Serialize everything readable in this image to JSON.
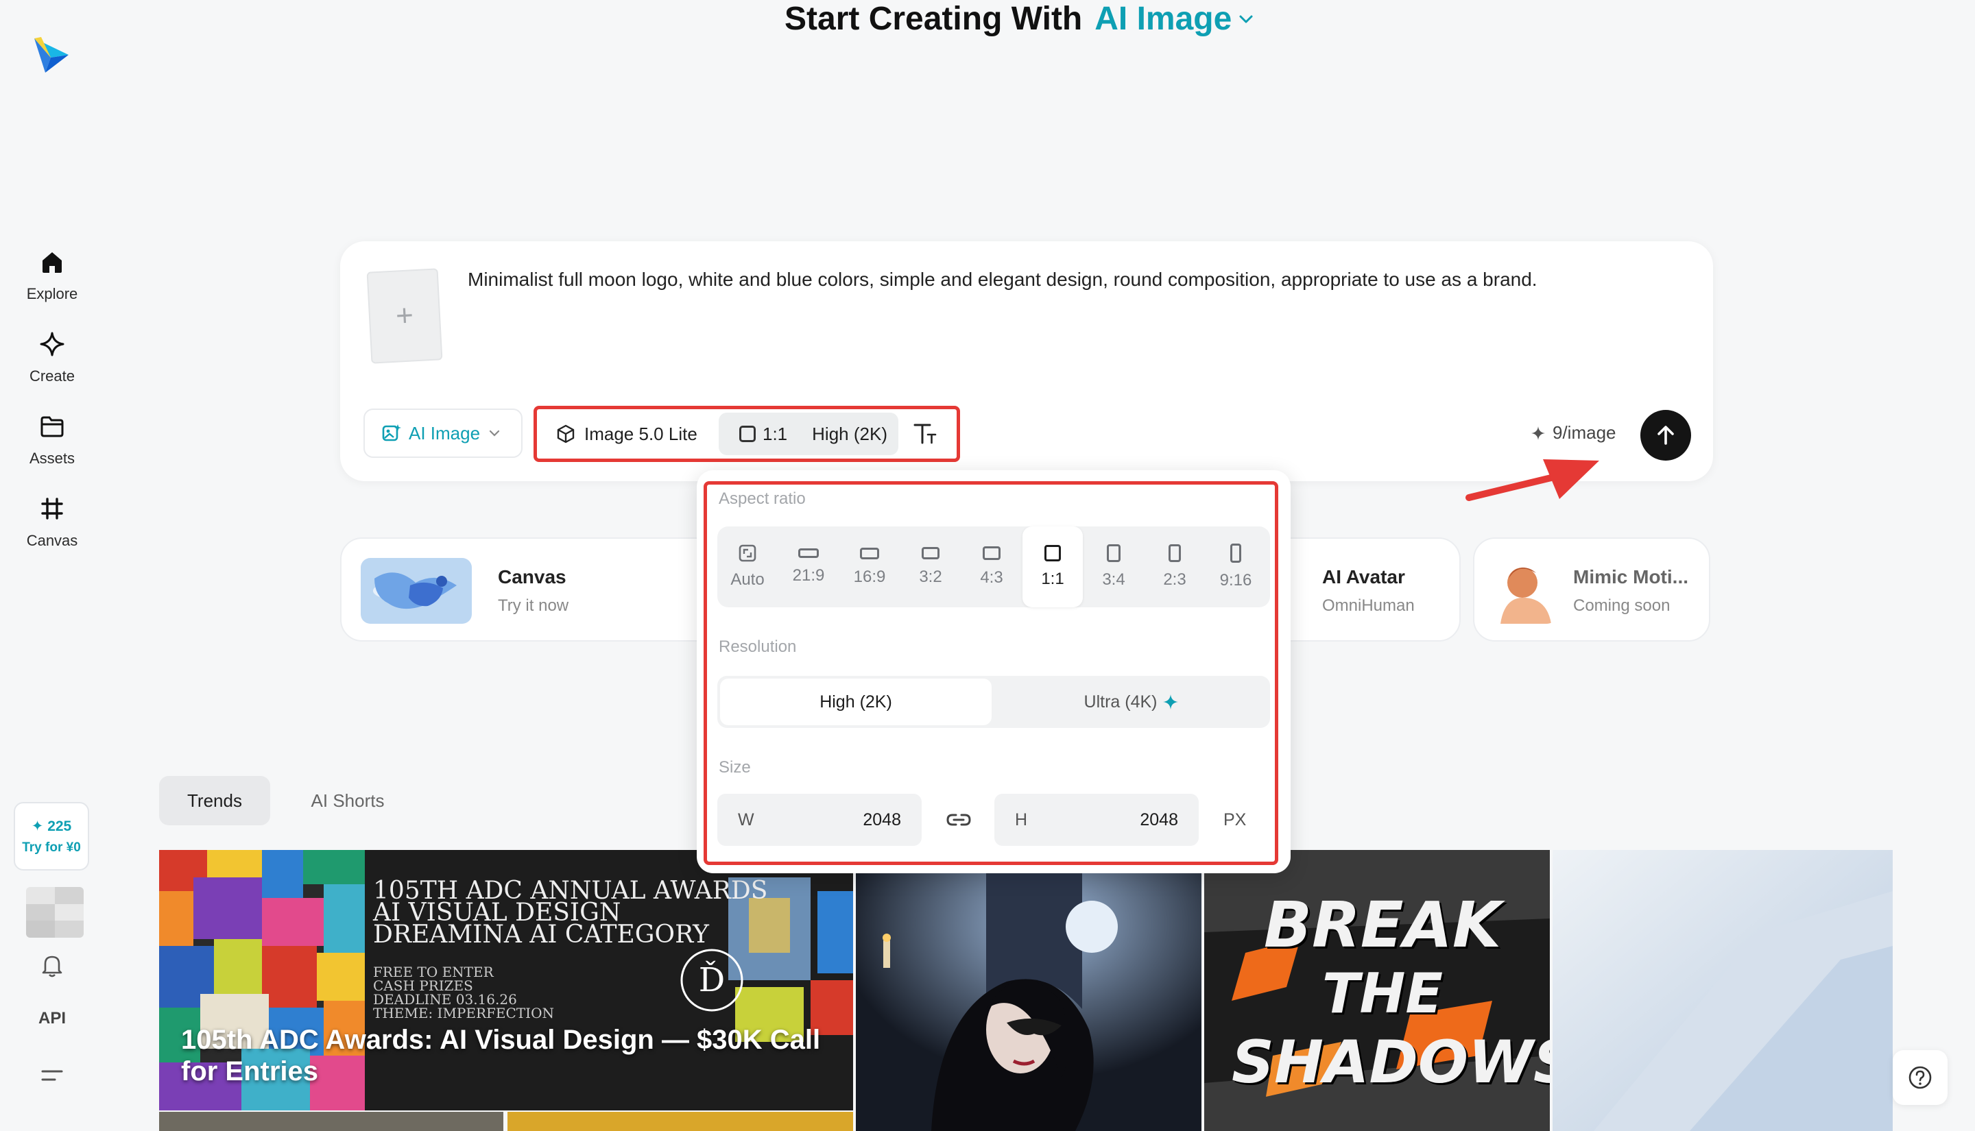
{
  "page": {
    "heading_prefix": "Start Creating With",
    "heading_accent": "AI Image"
  },
  "sidebar": {
    "items": [
      {
        "label": "Explore",
        "icon": "home-icon"
      },
      {
        "label": "Create",
        "icon": "sparkle-icon"
      },
      {
        "label": "Assets",
        "icon": "folder-icon"
      },
      {
        "label": "Canvas",
        "icon": "canvas-icon"
      }
    ],
    "credits": "✦ 225",
    "try_label": "Try for ¥0",
    "api_label": "API"
  },
  "prompt": {
    "text": "Minimalist full moon logo, white and blue colors, simple and elegant design, round composition, appropriate to use as a brand.",
    "upload_symbol": "+",
    "mode_label": "AI Image",
    "model_label": "Image 5.0 Lite",
    "ratio_label": "1:1",
    "resolution_label": "High (2K)",
    "cost_label": "9/image"
  },
  "features": [
    {
      "title": "Canvas",
      "subtitle": "Try it now"
    },
    {
      "title": "AI Avatar",
      "subtitle": "OmniHuman"
    },
    {
      "title": "Mimic Moti...",
      "subtitle": "Coming soon"
    }
  ],
  "popover": {
    "aspect_label": "Aspect ratio",
    "ratios": [
      "Auto",
      "21:9",
      "16:9",
      "3:2",
      "4:3",
      "1:1",
      "3:4",
      "2:3",
      "9:16"
    ],
    "selected_ratio": "1:1",
    "resolution_label": "Resolution",
    "resolution_options": [
      "High (2K)",
      "Ultra (4K)"
    ],
    "selected_resolution": "High (2K)",
    "size_label": "Size",
    "width_key": "W",
    "width_value": "2048",
    "height_key": "H",
    "height_value": "2048",
    "unit": "PX"
  },
  "tabs": [
    "Trends",
    "AI Shorts"
  ],
  "gallery": {
    "adc_lines": [
      "105TH ADC ANNUAL AWARDS",
      "AI VISUAL DESIGN",
      "DREAMINA AI CATEGORY"
    ],
    "adc_small": [
      "FREE TO ENTER",
      "CASH PRIZES",
      "DEADLINE 03.16.26",
      "THEME: IMPERFECTION"
    ],
    "adc_caption": "105th ADC Awards: AI Visual Design — $30K Call for Entries",
    "graffiti": [
      "BREAK",
      "THE",
      "SHADOWS"
    ]
  },
  "colors": {
    "accent": "#0e9fb3",
    "highlight": "#e53935",
    "send": "#141414"
  }
}
